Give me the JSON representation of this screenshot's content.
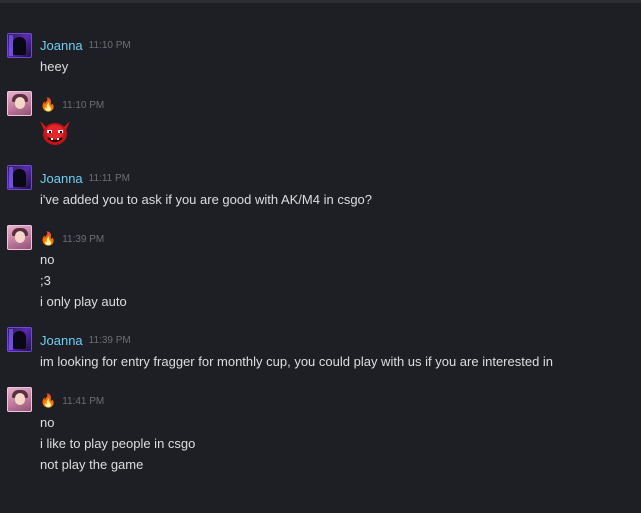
{
  "messages": [
    {
      "sender": "Joanna",
      "time": "11:10 PM",
      "lines": [
        "heey"
      ]
    },
    {
      "sender": "🔥",
      "time": "11:10 PM",
      "emoticon": "red-devil-emoticon"
    },
    {
      "sender": "Joanna",
      "time": "11:11 PM",
      "lines": [
        "i've added you to ask if you are good with AK/M4 in csgo?"
      ]
    },
    {
      "sender": "🔥",
      "time": "11:39 PM",
      "lines": [
        "no",
        ";3",
        "i only play auto"
      ]
    },
    {
      "sender": "Joanna",
      "time": "11:39 PM",
      "lines": [
        "im looking for entry fragger for monthly cup, you could play with us if you are interested in"
      ]
    },
    {
      "sender": "🔥",
      "time": "11:41 PM",
      "lines": [
        "no",
        "i like to play people in csgo",
        "not play the game"
      ]
    }
  ],
  "colors": {
    "background": "#1e1f24",
    "sender_name": "#6dcff6",
    "timestamp": "#6b6e75",
    "message_text": "#dcdedf"
  }
}
